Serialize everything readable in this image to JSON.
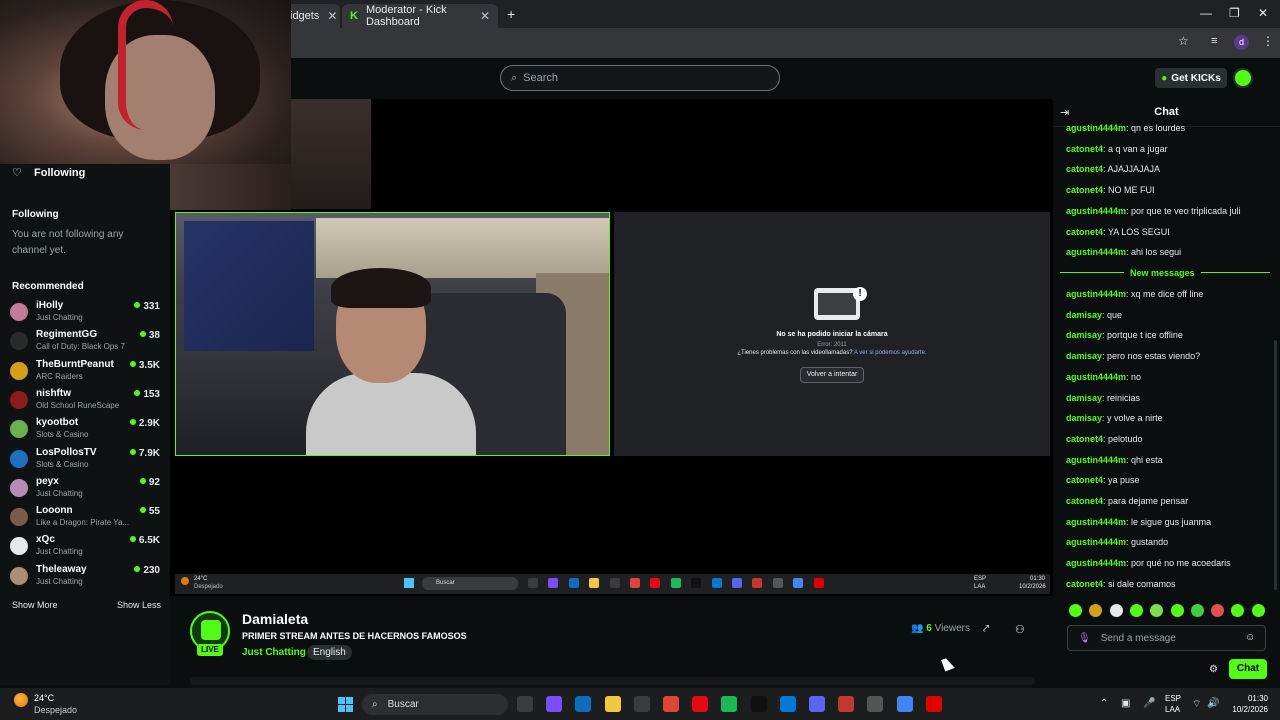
{
  "browser": {
    "tabs": [
      {
        "label": "idgets"
      },
      {
        "label": "Moderator - Kick Dashboard"
      }
    ],
    "new_tab": "+",
    "profile_initial": "d"
  },
  "header": {
    "search_placeholder": "Search",
    "get_kicks_label": "Get KICKs"
  },
  "sidebar": {
    "following_nav": "Following",
    "following_title": "Following",
    "following_empty": "You are not following any channel yet.",
    "recommended_title": "Recommended",
    "recommended": [
      {
        "name": "iHolly",
        "category": "Just Chatting",
        "viewers": "331",
        "color": "#c47b9b"
      },
      {
        "name": "RegimentGG",
        "category": "Call of Duty: Black Ops 7",
        "viewers": "38",
        "color": "#2a2a2a"
      },
      {
        "name": "TheBurntPeanut",
        "category": "ARC Raiders",
        "viewers": "3.5K",
        "color": "#d4a017"
      },
      {
        "name": "nishftw",
        "category": "Old School RuneScape",
        "viewers": "153",
        "color": "#8b1a1a"
      },
      {
        "name": "kyootbot",
        "category": "Slots & Casino",
        "viewers": "2.9K",
        "color": "#6ab04c"
      },
      {
        "name": "LosPollosTV",
        "category": "Slots & Casino",
        "viewers": "7.9K",
        "color": "#1e6fbf"
      },
      {
        "name": "peyx",
        "category": "Just Chatting",
        "viewers": "92",
        "color": "#b58bb8"
      },
      {
        "name": "Looonn",
        "category": "Like a Dragon: Pirate Ya...",
        "viewers": "55",
        "color": "#7a5c4a"
      },
      {
        "name": "xQc",
        "category": "Just Chatting",
        "viewers": "6.5K",
        "color": "#e8e8e8"
      },
      {
        "name": "Theleaway",
        "category": "Just Chatting",
        "viewers": "230",
        "color": "#a89070"
      }
    ],
    "show_more": "Show More",
    "show_less": "Show Less"
  },
  "camera_error": {
    "title": "No se ha podido iniciar la cámara",
    "code": "Error: 2011",
    "help_text": "¿Tienes problemas con las videollamadas?",
    "help_link": "A ver si podemos ayudarte.",
    "retry": "Volver a intentar"
  },
  "inner_taskbar": {
    "temp": "24°C",
    "cond": "Despejado",
    "search": "Buscar",
    "lang": "ESP",
    "lang2": "LAA",
    "time": "01:30",
    "date": "10/2/2026"
  },
  "stream": {
    "live_badge": "LIVE",
    "streamer": "Damialeta",
    "title": "PRIMER STREAM ANTES DE HACERNOS FAMOSOS",
    "category": "Just Chatting",
    "language": "English",
    "viewers_count": "6",
    "viewers_label": "Viewers"
  },
  "chat": {
    "title": "Chat",
    "messages_before": [
      {
        "user": "agustin4444m",
        "text": "qn es lourdes"
      },
      {
        "user": "catonet4",
        "text": "a q van a jugar"
      },
      {
        "user": "catonet4",
        "text": "AJAJJAJAJA"
      },
      {
        "user": "catonet4",
        "text": "NO ME FUI"
      },
      {
        "user": "agustin4444m",
        "text": "por que te veo triplicada juli"
      },
      {
        "user": "catonet4",
        "text": "YA LOS SEGUI"
      },
      {
        "user": "agustin4444m",
        "text": "ahi los segui"
      }
    ],
    "new_messages_label": "New messages",
    "messages_after": [
      {
        "user": "agustin4444m",
        "text": "xq me dice off line"
      },
      {
        "user": "damisay",
        "text": "que"
      },
      {
        "user": "damisay",
        "text": "portque t ice offline"
      },
      {
        "user": "damisay",
        "text": "pero nos estas viendo?"
      },
      {
        "user": "agustin4444m",
        "text": "no"
      },
      {
        "user": "damisay",
        "text": "reinicias"
      },
      {
        "user": "damisay",
        "text": "y volve a nirte"
      },
      {
        "user": "catonet4",
        "text": "pelotudo"
      },
      {
        "user": "agustin4444m",
        "text": "qhi esta"
      },
      {
        "user": "catonet4",
        "text": "ya puse"
      },
      {
        "user": "catonet4",
        "text": "para dejame pensar"
      },
      {
        "user": "agustin4444m",
        "text": "le sigue gus juanma"
      },
      {
        "user": "agustin4444m",
        "text": "gustando"
      },
      {
        "user": "agustin4444m",
        "text": "por qué no me acoedaris"
      },
      {
        "user": "catonet4",
        "text": "si dale comamos"
      }
    ],
    "input_placeholder": "Send a message",
    "send_label": "Chat"
  },
  "os_taskbar": {
    "temp": "24°C",
    "cond": "Despejado",
    "search": "Buscar",
    "lang": "ESP",
    "lang2": "LAA",
    "time": "01:30",
    "date": "10/2/2026"
  },
  "colors": {
    "kick_green": "#53fc18",
    "background": "#0b0e0f"
  }
}
